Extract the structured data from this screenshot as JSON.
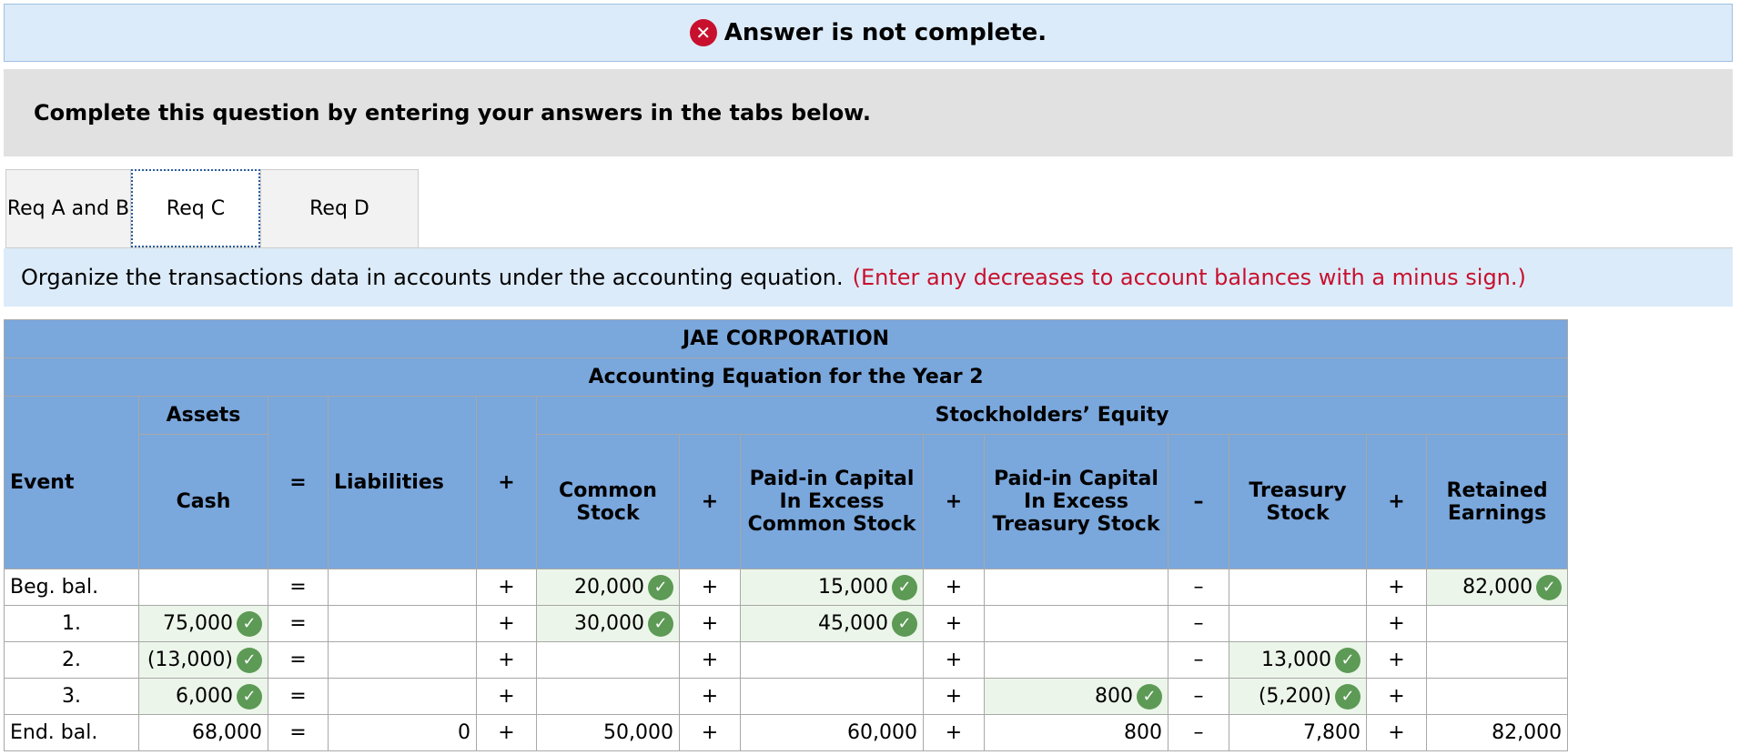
{
  "banner": {
    "text": "Answer is not complete."
  },
  "question": {
    "text": "Complete this question by entering your answers in the tabs below."
  },
  "tabs": [
    {
      "label": "Req A and B"
    },
    {
      "label": "Req C"
    },
    {
      "label": "Req D"
    }
  ],
  "instructions": {
    "main": "Organize the transactions data in accounts under the accounting equation.",
    "note": "(Enter any decreases to account balances with a minus sign.)"
  },
  "table": {
    "company": "JAE CORPORATION",
    "subtitle": "Accounting Equation for the Year 2",
    "assets_header": "Assets",
    "equity_header": "Stockholders’ Equity",
    "columns": {
      "event": "Event",
      "cash": "Cash",
      "liabilities": "Liabilities",
      "common_stock": "Common Stock",
      "pic_common": "Paid-in Capital In Excess Common Stock",
      "pic_treasury": "Paid-in Capital In Excess Treasury Stock",
      "treasury": "Treasury Stock",
      "retained": "Retained Earnings"
    },
    "operators": {
      "eq": "=",
      "plus": "+",
      "minus": "–"
    },
    "rows": [
      {
        "event": "Beg. bal.",
        "cash": "",
        "liabilities": "",
        "common_stock": "20,000",
        "pic_common": "15,000",
        "pic_treasury": "",
        "treasury": "",
        "retained": "82,000"
      },
      {
        "event": "1.",
        "cash": "75,000",
        "liabilities": "",
        "common_stock": "30,000",
        "pic_common": "45,000",
        "pic_treasury": "",
        "treasury": "",
        "retained": ""
      },
      {
        "event": "2.",
        "cash": "(13,000)",
        "liabilities": "",
        "common_stock": "",
        "pic_common": "",
        "pic_treasury": "",
        "treasury": "13,000",
        "retained": ""
      },
      {
        "event": "3.",
        "cash": "6,000",
        "liabilities": "",
        "common_stock": "",
        "pic_common": "",
        "pic_treasury": "800",
        "treasury": "(5,200)",
        "retained": ""
      },
      {
        "event": "End. bal.",
        "cash": "68,000",
        "liabilities": "0",
        "common_stock": "50,000",
        "pic_common": "60,000",
        "pic_treasury": "800",
        "treasury": "7,800",
        "retained": "82,000"
      }
    ]
  },
  "icons": {
    "error": "x-circle-icon",
    "correct": "check-circle-icon"
  },
  "colors": {
    "header_bg": "#7aa7dc",
    "error_red": "#c8102e",
    "check_green": "#5c9a55",
    "banner_bg": "#dcebf9"
  }
}
